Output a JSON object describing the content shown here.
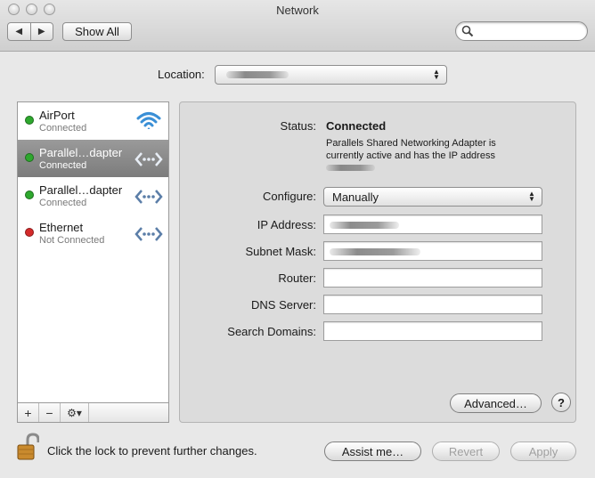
{
  "window": {
    "title": "Network"
  },
  "toolbar": {
    "back_glyph": "◀",
    "forward_glyph": "▶",
    "show_all_label": "Show All",
    "search": {
      "value": "",
      "placeholder": ""
    }
  },
  "location": {
    "label": "Location:",
    "value": ""
  },
  "services": [
    {
      "name": "AirPort",
      "status": "Connected",
      "status_color": "#2ea82e",
      "icon": "wifi-icon"
    },
    {
      "name": "Parallel…dapter",
      "status": "Connected",
      "status_color": "#2ea82e",
      "icon": "ethernet-icon",
      "selected": true
    },
    {
      "name": "Parallel…dapter",
      "status": "Connected",
      "status_color": "#2ea82e",
      "icon": "ethernet-icon"
    },
    {
      "name": "Ethernet",
      "status": "Not Connected",
      "status_color": "#d42a2a",
      "icon": "ethernet-icon"
    }
  ],
  "list_toolbar": {
    "add": "+",
    "remove": "−",
    "gear": "⚙▾"
  },
  "detail": {
    "status_label": "Status:",
    "status_value": "Connected",
    "status_description": "Parallels Shared Networking Adapter is currently active and has the IP address",
    "configure_label": "Configure:",
    "configure_value": "Manually",
    "ip_label": "IP Address:",
    "subnet_label": "Subnet Mask:",
    "router_label": "Router:",
    "dns_label": "DNS Server:",
    "search_domains_label": "Search Domains:",
    "router_value": "",
    "dns_value": "",
    "search_domains_value": "",
    "advanced_label": "Advanced…",
    "help_label": "?"
  },
  "footer": {
    "lock_text": "Click the lock to prevent further changes.",
    "assist_label": "Assist me…",
    "revert_label": "Revert",
    "apply_label": "Apply"
  },
  "colors": {
    "accent_selected": "#8a8a8a",
    "connected": "#2ea82e",
    "not_connected": "#d42a2a"
  }
}
